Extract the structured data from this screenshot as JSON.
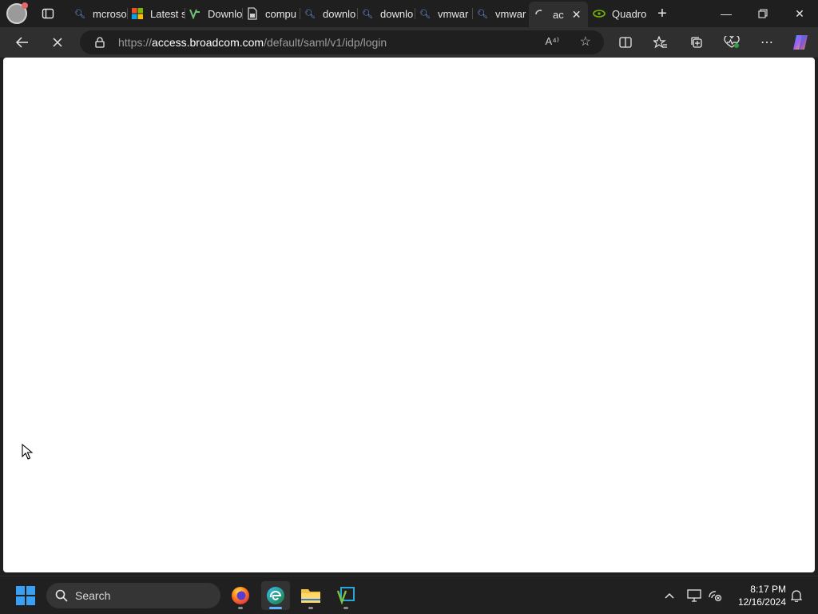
{
  "browser": {
    "tabs": [
      {
        "label": "mcroso",
        "icon": "search-icon"
      },
      {
        "label": "Latest s",
        "icon": "microsoft-logo-icon"
      },
      {
        "label": "Downlo",
        "icon": "vmware-icon"
      },
      {
        "label": "compu",
        "icon": "document-lock-icon"
      },
      {
        "label": "downlo",
        "icon": "search-icon"
      },
      {
        "label": "downlo",
        "icon": "search-icon"
      },
      {
        "label": "vmwar",
        "icon": "search-icon"
      },
      {
        "label": "vmwar",
        "icon": "search-icon"
      },
      {
        "label": "ac",
        "icon": "loading-spinner-icon",
        "active": true
      },
      {
        "label": "Quadro",
        "icon": "nvidia-icon"
      }
    ],
    "url_prefix": "https://",
    "url_host": "access.broadcom.com",
    "url_path": "/default/saml/v1/idp/login",
    "read_aloud_glyph": "A⁴⁾",
    "accent_color": "#5cb6ff"
  },
  "taskbar": {
    "search_placeholder": "Search",
    "time": "8:17 PM",
    "date": "12/16/2024",
    "apps": [
      "firefox-icon",
      "edge-icon",
      "file-explorer-icon",
      "vmware-workstation-icon"
    ]
  }
}
